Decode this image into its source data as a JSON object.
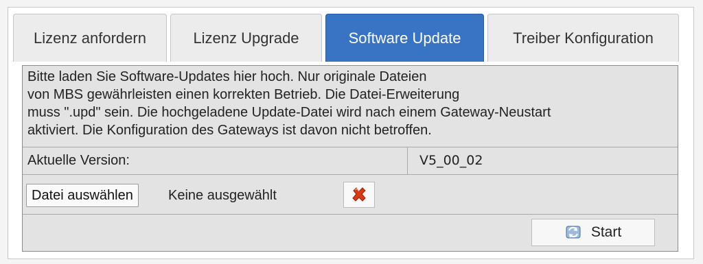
{
  "tabs": [
    {
      "label": "Lizenz anfordern",
      "active": false
    },
    {
      "label": "Lizenz Upgrade",
      "active": false
    },
    {
      "label": "Software Update",
      "active": true
    },
    {
      "label": "Treiber Konfiguration",
      "active": false
    }
  ],
  "description": {
    "lines": [
      "Bitte laden Sie Software-Updates hier hoch. Nur originale Dateien",
      "von MBS gewährleisten einen korrekten Betrieb. Die Datei-Erweiterung",
      "muss \".upd\" sein. Die hochgeladene Update-Datei wird nach einem Gateway-Neustart",
      "aktiviert. Die Konfiguration des Gateways ist davon nicht betroffen."
    ]
  },
  "version": {
    "label": "Aktuelle Version:",
    "value": "V5_00_02"
  },
  "file_upload": {
    "button_label": "Datei auswählen",
    "status": "Keine ausgewählt",
    "clear_icon": "red-x-icon"
  },
  "actions": {
    "start_label": "Start",
    "start_icon": "refresh-arrows-icon"
  },
  "colors": {
    "active_tab": "#3874c3",
    "panel_background": "#e3e3e3",
    "clear_icon": "#d93a14"
  }
}
